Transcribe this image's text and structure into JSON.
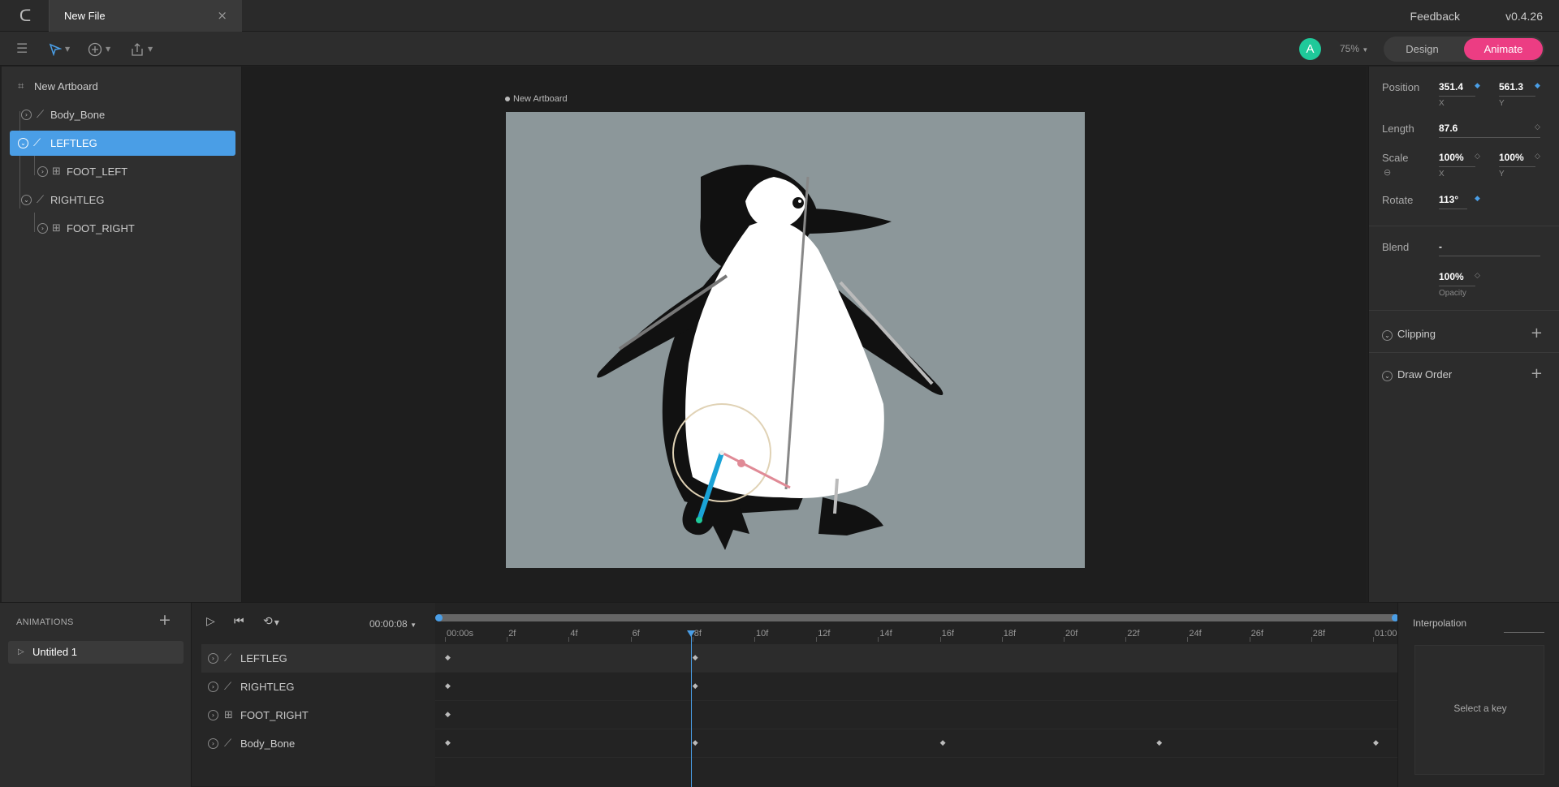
{
  "titlebar": {
    "tab_name": "New File",
    "close_glyph": "×",
    "feedback": "Feedback",
    "version": "v0.4.26"
  },
  "toolbar": {
    "avatar_letter": "A",
    "zoom": "75%",
    "mode_design": "Design",
    "mode_animate": "Animate"
  },
  "hierarchy": {
    "artboard": "New Artboard",
    "items": [
      {
        "label": "Body_Bone",
        "type": "bone"
      },
      {
        "label": "LEFTLEG",
        "type": "bone",
        "selected": true
      },
      {
        "label": "FOOT_LEFT",
        "type": "shape"
      },
      {
        "label": "RIGHTLEG",
        "type": "bone"
      },
      {
        "label": "FOOT_RIGHT",
        "type": "shape"
      }
    ]
  },
  "stage": {
    "artboard_label": "New Artboard"
  },
  "properties": {
    "position_label": "Position",
    "position_x": "351.4",
    "position_y": "561.3",
    "x_label": "X",
    "y_label": "Y",
    "length_label": "Length",
    "length": "87.6",
    "scale_label": "Scale",
    "scale_x": "100%",
    "scale_y": "100%",
    "rotate_label": "Rotate",
    "rotate": "113°",
    "blend_label": "Blend",
    "blend": "-",
    "opacity": "100%",
    "opacity_label": "Opacity",
    "clipping": "Clipping",
    "draw_order": "Draw Order"
  },
  "animations": {
    "title": "ANIMATIONS",
    "items": [
      "Untitled 1"
    ]
  },
  "timeline": {
    "time": "00:00:08",
    "ticks": [
      "00:00s",
      "2f",
      "4f",
      "6f",
      "8f",
      "10f",
      "12f",
      "14f",
      "16f",
      "18f",
      "20f",
      "22f",
      "24f",
      "26f",
      "28f",
      "01:00"
    ],
    "rows": [
      {
        "label": "LEFTLEG",
        "type": "bone",
        "keys": [
          0,
          8
        ]
      },
      {
        "label": "RIGHTLEG",
        "type": "bone",
        "keys": [
          0,
          8
        ]
      },
      {
        "label": "FOOT_RIGHT",
        "type": "shape",
        "keys": [
          0
        ]
      },
      {
        "label": "Body_Bone",
        "type": "bone",
        "keys": [
          0,
          8,
          16,
          23,
          30
        ]
      }
    ],
    "playhead_frame": 8
  },
  "interpolation": {
    "title": "Interpolation",
    "empty": "Select a key"
  }
}
